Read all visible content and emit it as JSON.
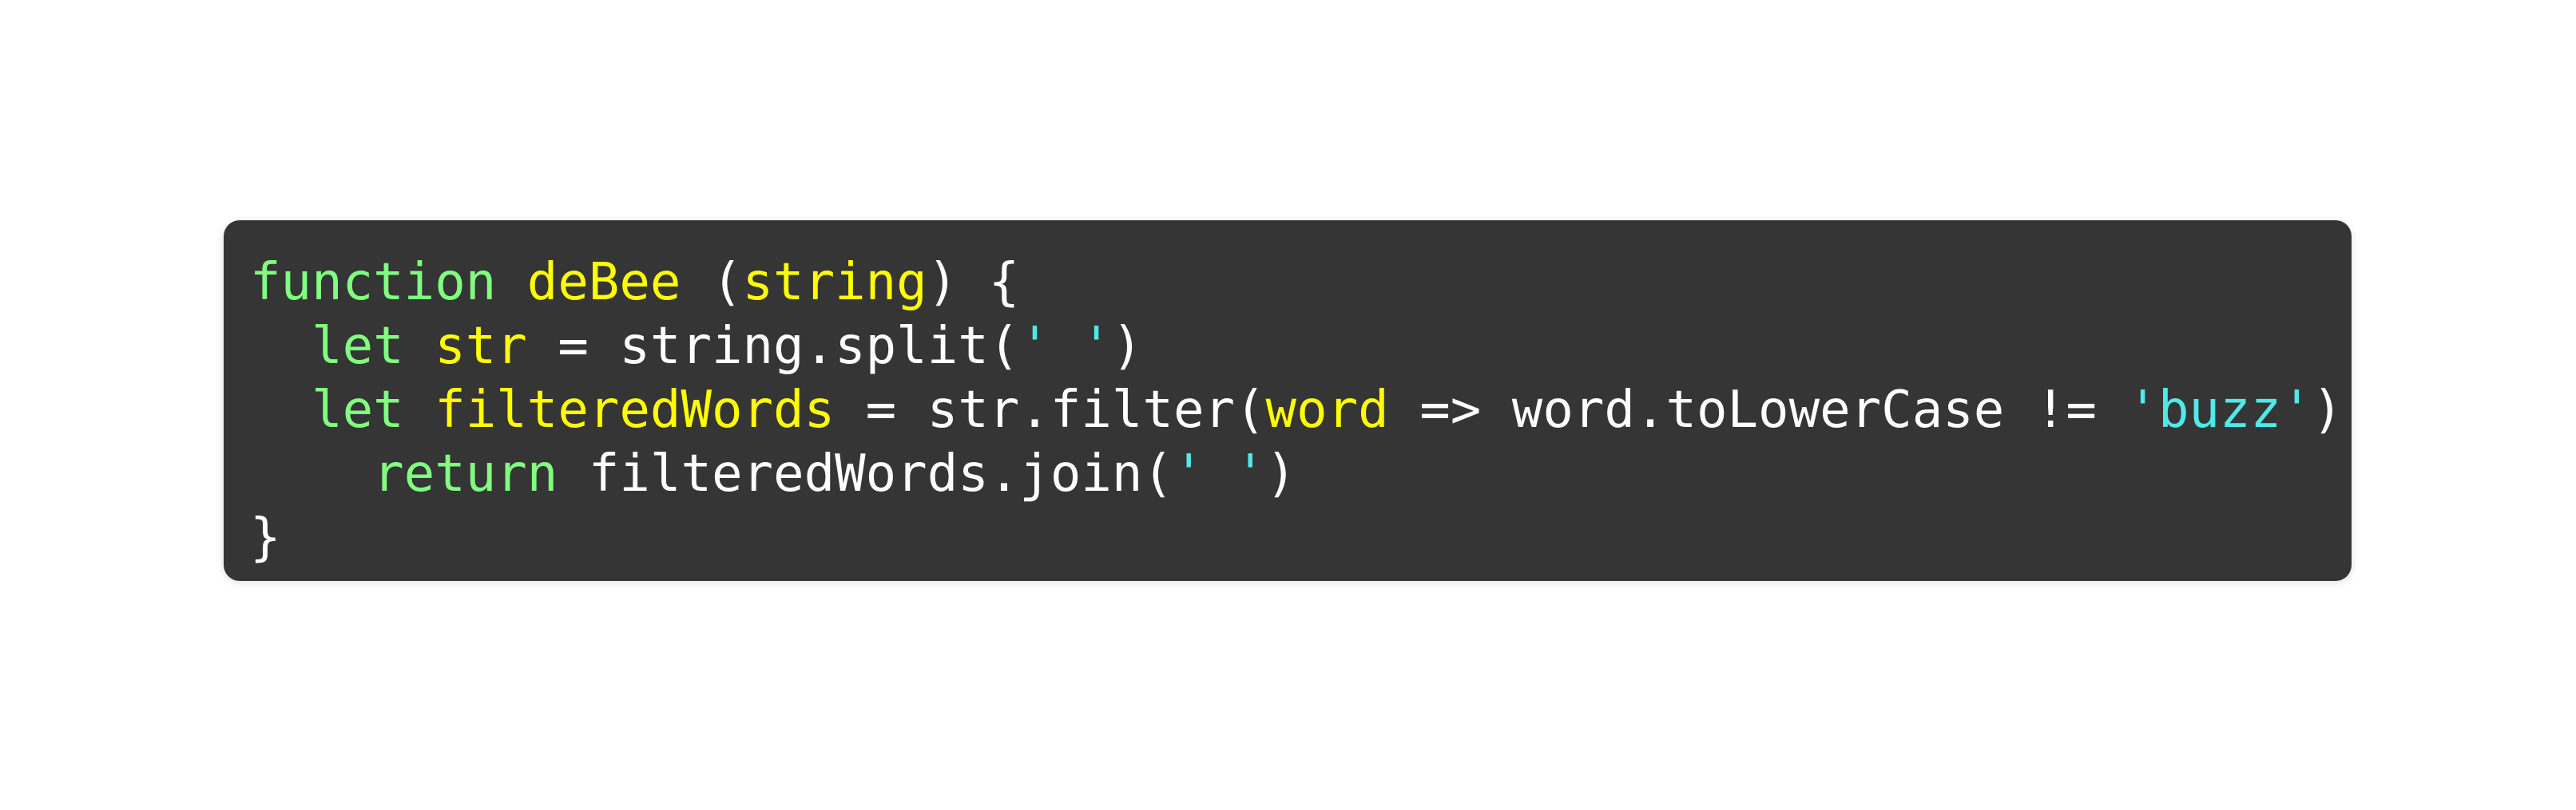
{
  "code": {
    "lines": [
      [
        {
          "t": "function",
          "c": "kw"
        },
        {
          "t": " ",
          "c": "pl"
        },
        {
          "t": "deBee",
          "c": "id"
        },
        {
          "t": " (",
          "c": "pl"
        },
        {
          "t": "string",
          "c": "id"
        },
        {
          "t": ") {",
          "c": "pl"
        }
      ],
      [
        {
          "t": "  ",
          "c": "pl"
        },
        {
          "t": "let",
          "c": "kw"
        },
        {
          "t": " ",
          "c": "pl"
        },
        {
          "t": "str",
          "c": "id"
        },
        {
          "t": " = string.split(",
          "c": "pl"
        },
        {
          "t": "' '",
          "c": "str"
        },
        {
          "t": ")",
          "c": "pl"
        }
      ],
      [
        {
          "t": "  ",
          "c": "pl"
        },
        {
          "t": "let",
          "c": "kw"
        },
        {
          "t": " ",
          "c": "pl"
        },
        {
          "t": "filteredWords",
          "c": "id"
        },
        {
          "t": " = str.filter(",
          "c": "pl"
        },
        {
          "t": "word",
          "c": "id"
        },
        {
          "t": " => word.toLowerCase != ",
          "c": "pl"
        },
        {
          "t": "'buzz'",
          "c": "str"
        },
        {
          "t": ")",
          "c": "pl"
        }
      ],
      [
        {
          "t": "    ",
          "c": "pl"
        },
        {
          "t": "return",
          "c": "kw"
        },
        {
          "t": " filteredWords.join(",
          "c": "pl"
        },
        {
          "t": "' '",
          "c": "str"
        },
        {
          "t": ")",
          "c": "pl"
        }
      ],
      [
        {
          "t": "}",
          "c": "pl"
        }
      ]
    ]
  },
  "colors": {
    "background": "#353535",
    "keyword": "#80ff80",
    "identifier": "#ffff00",
    "string": "#4eeaea",
    "plain": "#ffffff"
  }
}
